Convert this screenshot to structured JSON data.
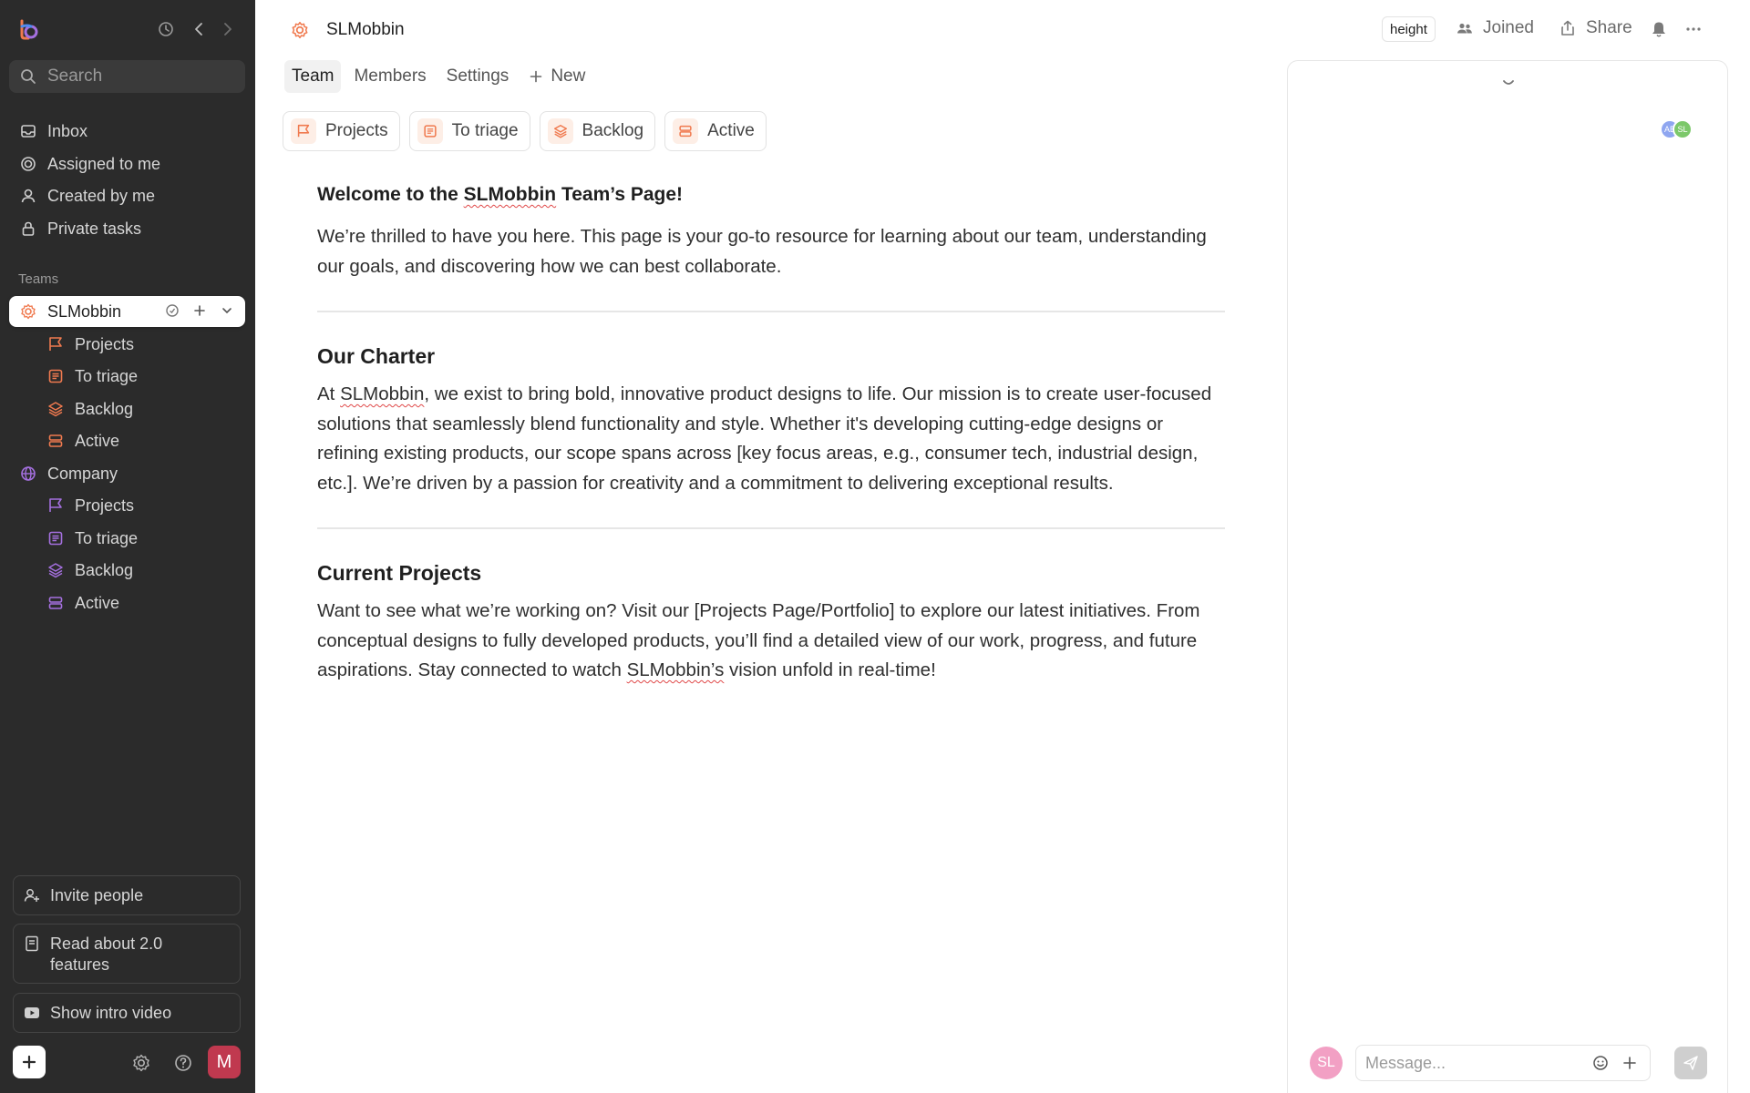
{
  "search": {
    "placeholder": "Search"
  },
  "nav": {
    "inbox": "Inbox",
    "assigned": "Assigned to me",
    "created": "Created by me",
    "private": "Private tasks"
  },
  "teams_label": "Teams",
  "teams": [
    {
      "name": "SLMobbin",
      "icon_color": "#f07a4f",
      "items": [
        "Projects",
        "To triage",
        "Backlog",
        "Active"
      ]
    },
    {
      "name": "Company",
      "icon_color": "#a570e0",
      "items": [
        "Projects",
        "To triage",
        "Backlog",
        "Active"
      ]
    }
  ],
  "sidebar_footer": {
    "invite": "Invite people",
    "read_about": "Read about 2.0 features",
    "intro_video": "Show intro video",
    "avatar_initial": "M"
  },
  "header": {
    "title": "SLMobbin",
    "chip": "height",
    "joined": "Joined",
    "share": "Share"
  },
  "tabs": [
    "Team",
    "Members",
    "Settings",
    "New"
  ],
  "views": [
    "Projects",
    "To triage",
    "Backlog",
    "Active"
  ],
  "doc": {
    "welcome_title_pre": "Welcome to the ",
    "welcome_title_brand": "SLMobbin",
    "welcome_title_post": " Team’s Page!",
    "welcome_body": "We’re thrilled to have you here. This page is your go-to resource for learning about our team, understanding our goals, and discovering how we can best collaborate.",
    "charter_title": "Our Charter",
    "charter_pre": "At ",
    "charter_brand": "SLMobbin",
    "charter_body": ", we exist to bring bold, innovative product designs to life. Our mission is to create user-focused solutions that seamlessly blend functionality and style. Whether it's developing cutting-edge designs or refining existing products, our scope spans across [key focus areas, e.g., consumer tech, industrial design, etc.]. We’re driven by a passion for creativity and a commitment to delivering exceptional results.",
    "projects_title": "Current Projects",
    "projects_pre": "Want to see what we’re working on? Visit our [Projects Page/Portfolio] to explore our latest initiatives. From conceptual designs to fully developed products, you’ll find a detailed view of our work, progress, and future aspirations. Stay connected to watch ",
    "projects_brand": "SLMobbin’s",
    "projects_post": " vision unfold in real-time!"
  },
  "panel": {
    "avatars": [
      "AB",
      "SL"
    ],
    "user_initials": "SL",
    "message_placeholder": "Message..."
  },
  "colors": {
    "accent_orange": "#f07a4f",
    "accent_purple": "#a570e0",
    "sidebar_bg": "#2b2b2b"
  }
}
